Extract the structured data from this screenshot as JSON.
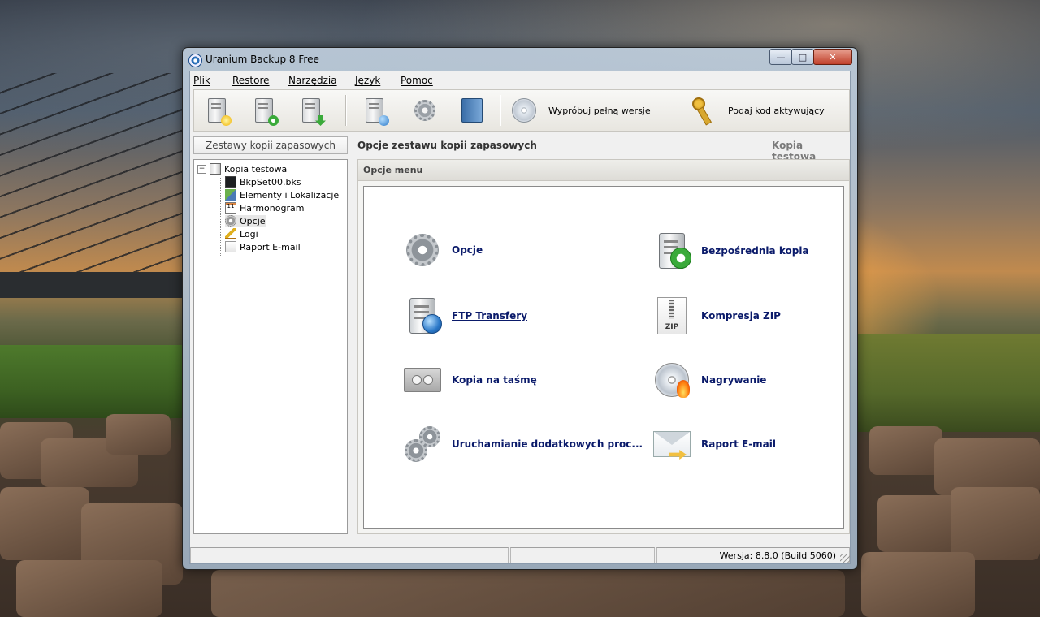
{
  "window": {
    "title": "Uranium Backup 8 Free"
  },
  "menu": [
    "Plik",
    "Restore",
    "Narzędzia",
    "Język",
    "Pomoc"
  ],
  "toolbar": {
    "try_full_label": "Wypróbuj pełną wersje",
    "activation_label": "Podaj kod aktywujący"
  },
  "left_panel": {
    "header": "Zestawy kopii zapasowych",
    "tree": {
      "root": "Kopia testowa",
      "children": [
        "BkpSet00.bks",
        "Elementy i Lokalizacje",
        "Harmonogram",
        "Opcje",
        "Logi",
        "Raport E-mail"
      ],
      "calendar_day": "11"
    }
  },
  "right_panel": {
    "title": "Opcje zestawu kopii zapasowych",
    "set_name": "Kopia testowa",
    "section_header": "Opcje menu",
    "options": [
      "Opcje",
      "Bezpośrednia kopia",
      "FTP Transfery",
      "Kompresja ZIP",
      "Kopia na taśmę",
      "Nagrywanie",
      "Uruchamianie dodatkowych proc...",
      "Raport E-mail"
    ],
    "zip_icon_text": "ZIP"
  },
  "statusbar": {
    "version": "Wersja: 8.8.0 (Build 5060)"
  }
}
